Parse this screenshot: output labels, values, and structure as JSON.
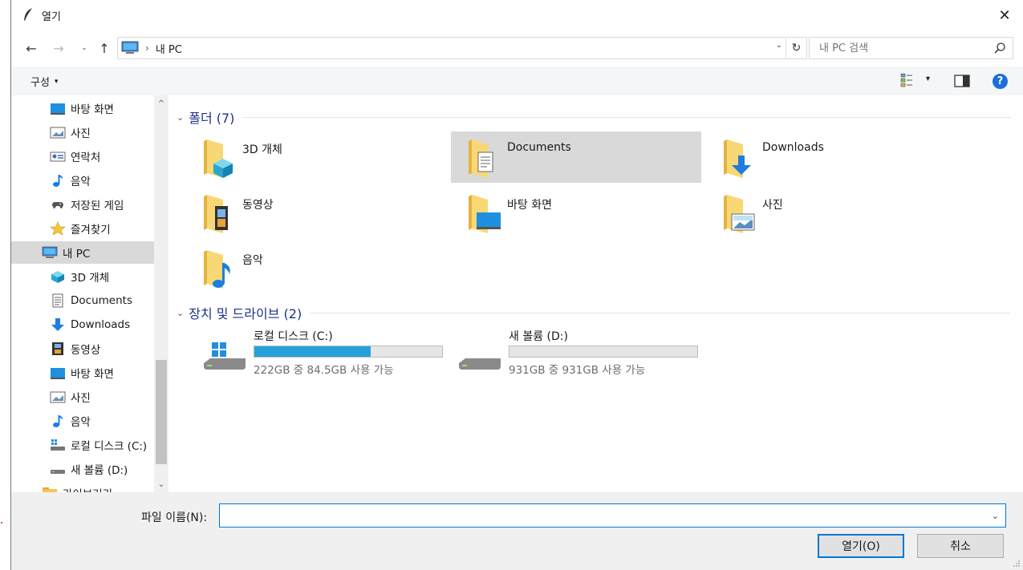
{
  "window": {
    "title": "열기",
    "close_glyph": "✕"
  },
  "navigation": {
    "back_glyph": "←",
    "forward_glyph": "→",
    "recent_glyph": "⌄",
    "up_glyph": "↑",
    "breadcrumb_sep": "›",
    "breadcrumb": "내 PC",
    "dropdown_glyph": "⌄",
    "refresh_glyph": "↻",
    "search_placeholder": "내 PC 검색"
  },
  "command_bar": {
    "organize_label": "구성",
    "organize_caret": "▾",
    "view_caret": "▾",
    "help_glyph": "?"
  },
  "sidebar": {
    "scroll_up_glyph": "^",
    "scroll_down_glyph": "⌄",
    "items": [
      {
        "label": "바탕 화면",
        "icon": "desktop-icon"
      },
      {
        "label": "사진",
        "icon": "pictures-icon"
      },
      {
        "label": "연락처",
        "icon": "contacts-icon"
      },
      {
        "label": "음악",
        "icon": "music-icon"
      },
      {
        "label": "저장된 게임",
        "icon": "saved-games-icon"
      },
      {
        "label": "즐겨찾기",
        "icon": "favorites-icon"
      },
      {
        "label": "내 PC",
        "icon": "this-pc-icon",
        "selected": true
      },
      {
        "label": "3D 개체",
        "icon": "3d-objects-icon"
      },
      {
        "label": "Documents",
        "icon": "documents-icon"
      },
      {
        "label": "Downloads",
        "icon": "downloads-icon"
      },
      {
        "label": "동영상",
        "icon": "videos-icon"
      },
      {
        "label": "바탕 화면",
        "icon": "desktop-icon"
      },
      {
        "label": "사진",
        "icon": "pictures-icon"
      },
      {
        "label": "음악",
        "icon": "music-icon"
      },
      {
        "label": "로컬 디스크 (C:)",
        "icon": "local-disk-icon"
      },
      {
        "label": "새 볼륨 (D:)",
        "icon": "drive-icon"
      },
      {
        "label": "라이브러리",
        "icon": "libraries-icon"
      }
    ]
  },
  "main": {
    "folders_header": "폴더 (7)",
    "folders_caret": "⌄",
    "folders": [
      {
        "label": "3D 개체",
        "icon": "3d-objects-folder-icon"
      },
      {
        "label": "Documents",
        "icon": "documents-folder-icon",
        "selected": true
      },
      {
        "label": "Downloads",
        "icon": "downloads-folder-icon"
      },
      {
        "label": "동영상",
        "icon": "videos-folder-icon"
      },
      {
        "label": "바탕 화면",
        "icon": "desktop-folder-icon"
      },
      {
        "label": "사진",
        "icon": "pictures-folder-icon"
      },
      {
        "label": "음악",
        "icon": "music-folder-icon"
      }
    ],
    "drives_header": "장치 및 드라이브 (2)",
    "drives_caret": "⌄",
    "drives": [
      {
        "label": "로컬 디스크 (C:)",
        "info": "222GB 중 84.5GB 사용 가능",
        "used_fraction": 0.62,
        "icon": "windows-drive-icon"
      },
      {
        "label": "새 볼륨 (D:)",
        "info": "931GB 중 931GB 사용 가능",
        "used_fraction": 0.0,
        "icon": "hard-drive-icon"
      }
    ]
  },
  "bottom": {
    "filename_label": "파일 이름(N):",
    "filename_value": "",
    "filename_caret": "⌄",
    "open_label": "열기(O)",
    "cancel_label": "취소"
  },
  "colors": {
    "accent": "#0078d7",
    "drive_bar": "#26a0da",
    "folder_yellow": "#f8d775",
    "header_blue": "#1e3287",
    "selection": "#d9d9d9"
  }
}
